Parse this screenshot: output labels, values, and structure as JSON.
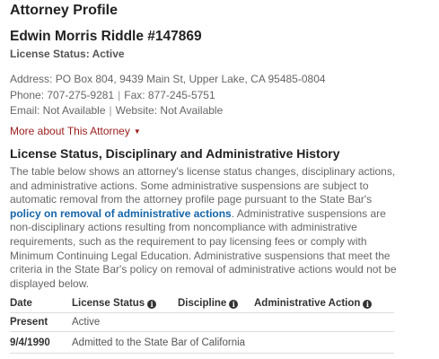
{
  "profile": {
    "heading": "Attorney Profile",
    "name": "Edwin Morris Riddle #147869",
    "license_status": "License Status: Active",
    "address": "Address: PO Box 804, 9439 Main St, Upper Lake, CA 95485-0804",
    "phone": "Phone: 707-275-9281",
    "fax": "Fax: 877-245-5751",
    "email": "Email: Not Available",
    "website": "Website: Not Available",
    "separator": "|",
    "more_link": "More about This Attorney",
    "caret_icon": "caret-down-icon"
  },
  "history": {
    "heading": "License Status, Disciplinary and Administrative History",
    "para_1": "The table below shows an attorney's license status changes, disciplinary actions, and administrative actions. Some administrative suspensions are subject to automatic removal from the attorney profile page pursuant to the State Bar's ",
    "policy_link": "policy on removal of administrative actions",
    "para_2": ". Administrative suspensions are non-disciplinary actions resulting from noncompliance with administrative requirements, such as the requirement to pay licensing fees or comply with Minimum Continuing Legal Education. Administrative suspensions that meet the criteria in the State Bar's policy on removal of administrative actions would not be displayed below.",
    "info_icon": "info-circle-icon",
    "info_glyph": "i",
    "columns": {
      "date": "Date",
      "license_status": "License Status",
      "discipline": "Discipline",
      "administrative_action": "Administrative Action"
    },
    "rows": [
      {
        "date": "Present",
        "license_status": "Active",
        "discipline": "",
        "administrative_action": ""
      },
      {
        "date": "9/4/1990",
        "license_status": "Admitted to the State Bar of California",
        "discipline": "",
        "administrative_action": ""
      }
    ]
  }
}
